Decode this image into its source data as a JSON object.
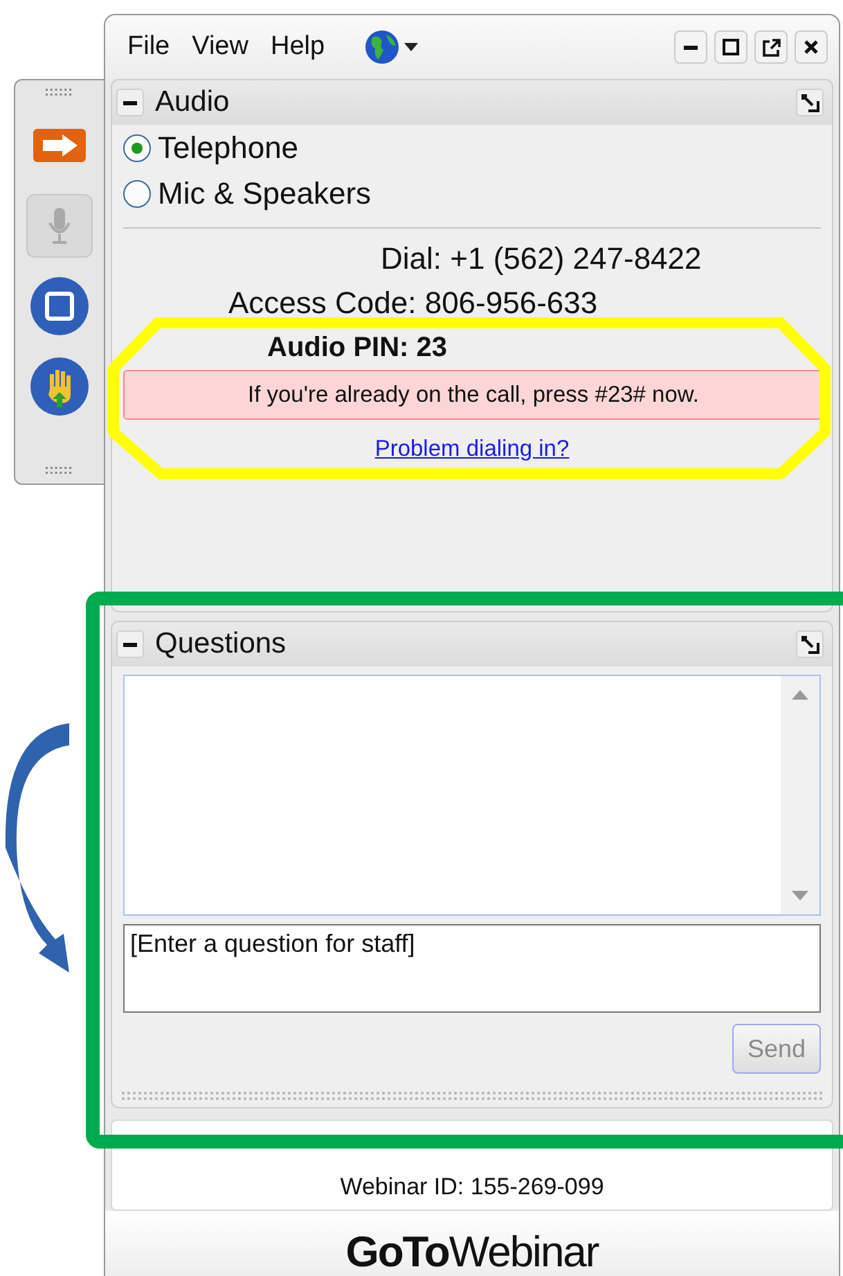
{
  "menu": [
    "File",
    "View",
    "Help"
  ],
  "toolbar": [
    {
      "kind": "screen",
      "disabled": false
    },
    {
      "kind": "mic",
      "disabled": true
    },
    {
      "kind": "stop",
      "disabled": false
    },
    {
      "kind": "hand",
      "disabled": false
    }
  ],
  "audio": {
    "title": "Audio",
    "options": [
      {
        "label": "Telephone",
        "selected": true
      },
      {
        "label": "Mic & Speakers",
        "selected": false
      }
    ],
    "dial": "Dial: +1 (562) 247-8422",
    "access_code": "Access Code: 806-956-633",
    "pin": "Audio PIN: 23",
    "notice": "If you're already on the call, press #23# now.",
    "link": "Problem dialing in?"
  },
  "questions": {
    "title": "Questions",
    "placeholder": "[Enter a question for staff]",
    "send": {
      "label": "Send",
      "disabled": true
    }
  },
  "footer": {
    "webinar_id": "Webinar ID: 155-269-099",
    "brand": "**GoTo**Webinar"
  }
}
